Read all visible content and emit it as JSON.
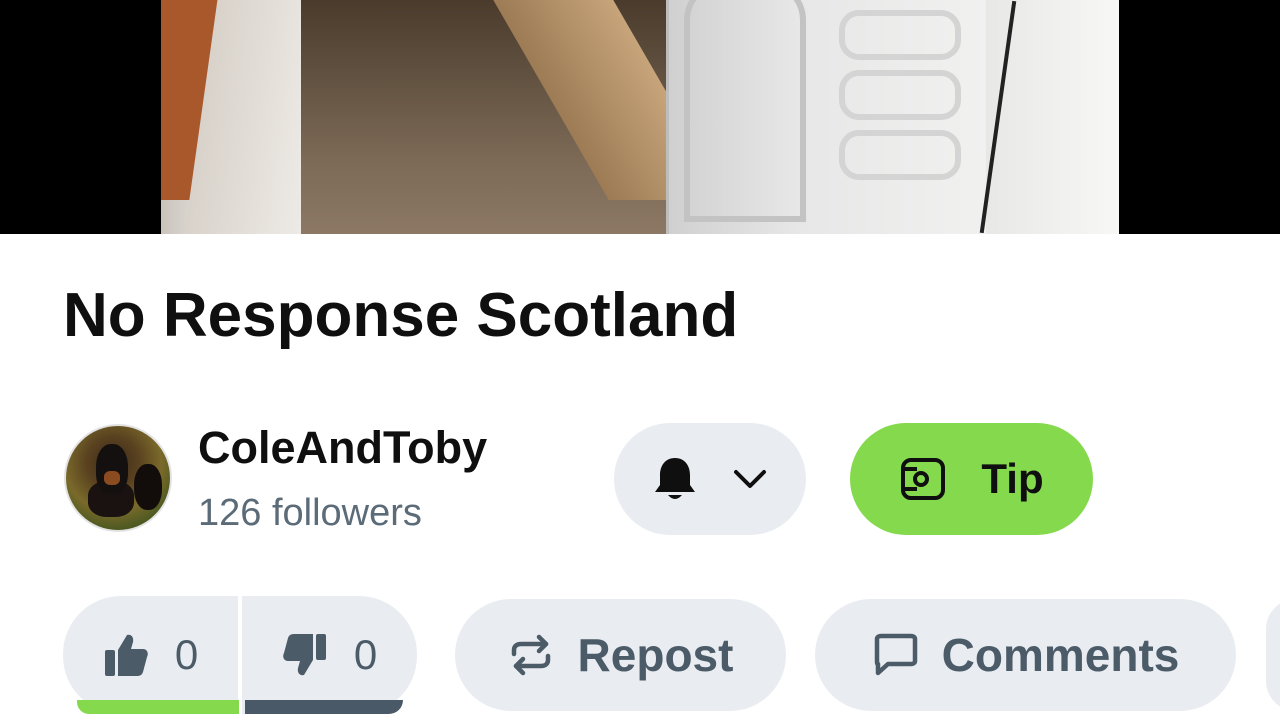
{
  "video": {
    "thumbnail_icon": "video-frame-laundry-room"
  },
  "title": "No Response Scotland",
  "channel": {
    "name": "ColeAndToby",
    "followers": "126 followers",
    "avatar_icon": "avatar-dogs"
  },
  "actions": {
    "notify_icon": "bell-icon",
    "notify_dropdown_icon": "chevron-down-icon",
    "tip_label": "Tip",
    "tip_icon": "tip-icon"
  },
  "engagement": {
    "likes": "0",
    "dislikes": "0",
    "repost_label": "Repost",
    "comments_label": "Comments"
  },
  "colors": {
    "accent_green": "#85d94c",
    "pill_bg": "#e9edf1",
    "muted_text": "#5b6b78",
    "dislike_bar": "#4a5967"
  }
}
